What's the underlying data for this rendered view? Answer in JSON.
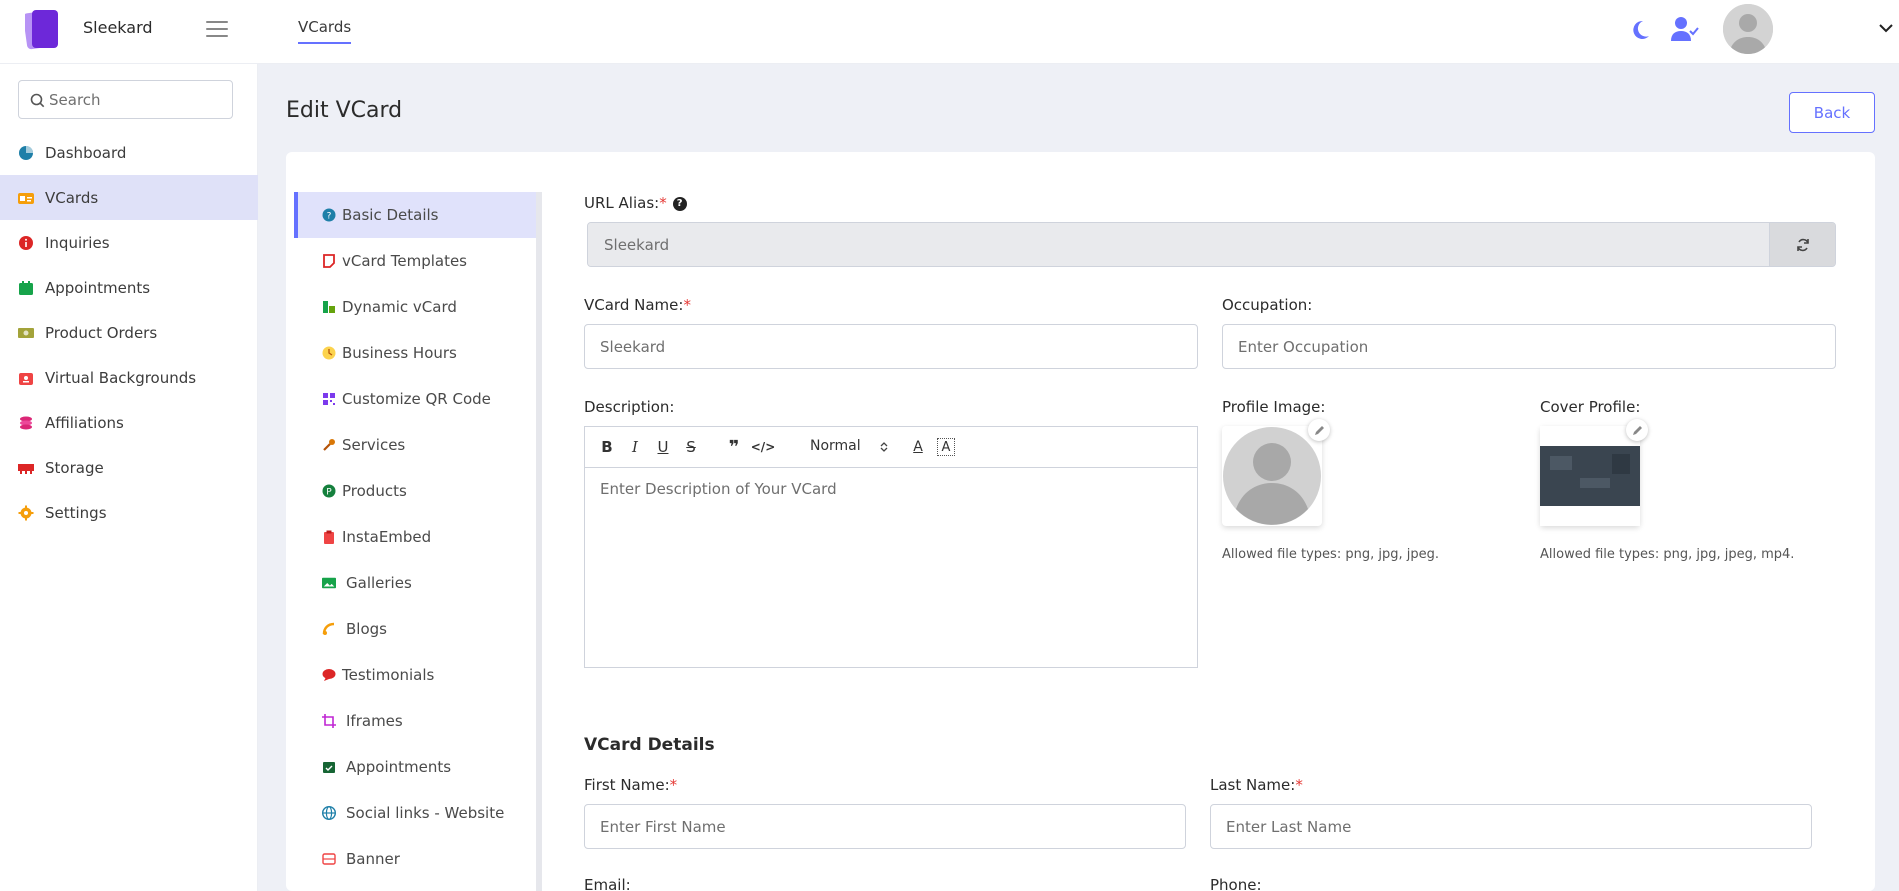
{
  "app": {
    "name": "Sleekard"
  },
  "topbar": {
    "tab": "VCards"
  },
  "sidebar": {
    "search_placeholder": "Search",
    "items": [
      {
        "label": "Dashboard"
      },
      {
        "label": "VCards"
      },
      {
        "label": "Inquiries"
      },
      {
        "label": "Appointments"
      },
      {
        "label": "Product Orders"
      },
      {
        "label": "Virtual Backgrounds"
      },
      {
        "label": "Affiliations"
      },
      {
        "label": "Storage"
      },
      {
        "label": "Settings"
      }
    ]
  },
  "page": {
    "title": "Edit VCard",
    "back_label": "Back"
  },
  "tabs": [
    {
      "label": "Basic Details"
    },
    {
      "label": "vCard Templates"
    },
    {
      "label": "Dynamic vCard"
    },
    {
      "label": "Business Hours"
    },
    {
      "label": "Customize QR Code"
    },
    {
      "label": "Services"
    },
    {
      "label": "Products"
    },
    {
      "label": "InstaEmbed"
    },
    {
      "label": "Galleries"
    },
    {
      "label": "Blogs"
    },
    {
      "label": "Testimonials"
    },
    {
      "label": "Iframes"
    },
    {
      "label": "Appointments"
    },
    {
      "label": "Social links - Website"
    },
    {
      "label": "Banner"
    }
  ],
  "form": {
    "url_alias": {
      "label": "URL Alias:",
      "req": "*",
      "value": "Sleekard"
    },
    "vcard_name": {
      "label": "VCard Name:",
      "req": "*",
      "value": "Sleekard"
    },
    "occupation": {
      "label": "Occupation:",
      "placeholder": "Enter Occupation"
    },
    "description": {
      "label": "Description:",
      "placeholder": "Enter Description of Your VCard",
      "format": "Normal"
    },
    "profile_image": {
      "label": "Profile Image:",
      "hint": "Allowed file types: png, jpg, jpeg."
    },
    "cover_profile": {
      "label": "Cover Profile:",
      "hint": "Allowed file types: png, jpg, jpeg, mp4."
    },
    "details_title": "VCard Details",
    "first_name": {
      "label": "First Name:",
      "req": "*",
      "placeholder": "Enter First Name"
    },
    "last_name": {
      "label": "Last Name:",
      "req": "*",
      "placeholder": "Enter Last Name"
    },
    "email": {
      "label": "Email:"
    },
    "phone": {
      "label": "Phone:"
    }
  },
  "colors": {
    "accent": "#6571ff",
    "active_bg": "#dfe1f8",
    "required": "#e53935"
  }
}
